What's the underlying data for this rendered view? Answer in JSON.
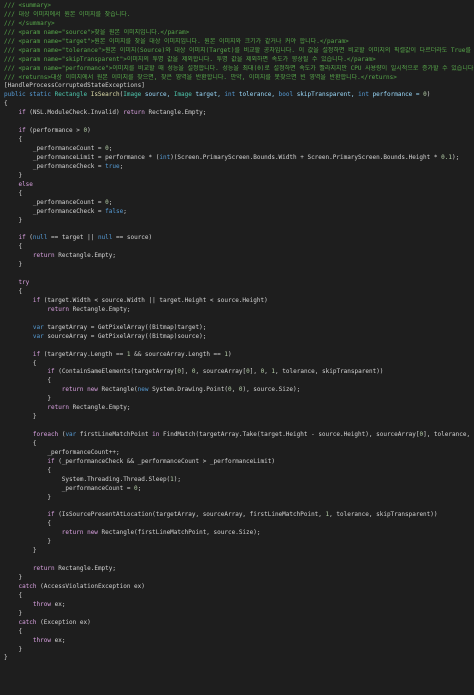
{
  "theme": {
    "background": "#1e1e1e",
    "colors": {
      "plain": "#d4d4d4",
      "comment": "#57a64a",
      "keyword": "#569cd6",
      "control": "#d8a0df",
      "type": "#4ec9b0",
      "number": "#b5cea8",
      "param": "#9cdcfe",
      "method": "#dcdcaa"
    }
  },
  "code": {
    "language": "csharp",
    "lines": [
      [
        {
          "t": "/// <summary>",
          "k": "comment"
        }
      ],
      [
        {
          "t": "/// 대상 이미지에서 원본 이미지를 찾습니다.",
          "k": "comment"
        }
      ],
      [
        {
          "t": "/// </summary>",
          "k": "comment"
        }
      ],
      [
        {
          "t": "/// <param name=\"source\">찾을 원본 이미지입니다.</param>",
          "k": "comment"
        }
      ],
      [
        {
          "t": "/// <param name=\"target\">원본 이미지를 찾을 대상 이미지입니다. 원본 이미지와 크기가 같거나 커야 합니다.</param>",
          "k": "comment"
        }
      ],
      [
        {
          "t": "/// <param name=\"tolerance\">원본 이미지(Source)와 대상 이미지(Target)를 비교할 공차입니다. 이 값을 설정하면 비교할 이미지의 픽셀값이 다르더라도 True를 반환합니다.</param>",
          "k": "comment"
        }
      ],
      [
        {
          "t": "/// <param name=\"skipTransparent\">이미지의 투명 값을 제외합니다. 투명 값을 제외하면 속도가 향상될 수 있습니다.</param>",
          "k": "comment"
        }
      ],
      [
        {
          "t": "/// <param name=\"performance\">이미지를 비교할 때 성능을 설정합니다. 성능을 최대(0)로 설정하면 속도가 빨라지지만 CPU 사용량이 일시적으로 증가할 수 있습니다.</param>",
          "k": "comment"
        }
      ],
      [
        {
          "t": "/// <returns>대상 이미지에서 원본 이미지를 찾으면, 찾은 영역을 반환합니다. 만약, 이미지를 못찾으면 빈 영역을 반환합니다.</returns>",
          "k": "comment"
        }
      ],
      [
        {
          "t": "[HandleProcessCorruptedStateExceptions]",
          "k": "plain"
        }
      ],
      [
        {
          "t": "public static ",
          "k": "keyword"
        },
        {
          "t": "Rectangle ",
          "k": "type"
        },
        {
          "t": "IsSearch",
          "k": "method"
        },
        {
          "t": "(",
          "k": "plain"
        },
        {
          "t": "Image ",
          "k": "type"
        },
        {
          "t": "source, ",
          "k": "param"
        },
        {
          "t": "Image ",
          "k": "type"
        },
        {
          "t": "target, ",
          "k": "param"
        },
        {
          "t": "int ",
          "k": "keyword"
        },
        {
          "t": "tolerance, ",
          "k": "param"
        },
        {
          "t": "bool ",
          "k": "keyword"
        },
        {
          "t": "skipTransparent, ",
          "k": "param"
        },
        {
          "t": "int ",
          "k": "keyword"
        },
        {
          "t": "performance = ",
          "k": "param"
        },
        {
          "t": "0",
          "k": "number"
        },
        {
          "t": ")",
          "k": "plain"
        }
      ],
      [
        {
          "t": "{",
          "k": "plain"
        }
      ],
      [
        {
          "t": "    ",
          "k": "plain"
        },
        {
          "t": "if ",
          "k": "control"
        },
        {
          "t": "(NSL.ModuleCheck.Invalid) ",
          "k": "plain"
        },
        {
          "t": "return ",
          "k": "control"
        },
        {
          "t": "Rectangle.Empty;",
          "k": "plain"
        }
      ],
      [
        {
          "t": "",
          "k": "plain"
        }
      ],
      [
        {
          "t": "    ",
          "k": "plain"
        },
        {
          "t": "if ",
          "k": "control"
        },
        {
          "t": "(performance > ",
          "k": "plain"
        },
        {
          "t": "0",
          "k": "number"
        },
        {
          "t": ")",
          "k": "plain"
        }
      ],
      [
        {
          "t": "    {",
          "k": "plain"
        }
      ],
      [
        {
          "t": "        _performanceCount = ",
          "k": "plain"
        },
        {
          "t": "0",
          "k": "number"
        },
        {
          "t": ";",
          "k": "plain"
        }
      ],
      [
        {
          "t": "        _performanceLimit = performance * (",
          "k": "plain"
        },
        {
          "t": "int",
          "k": "keyword"
        },
        {
          "t": ")(Screen.PrimaryScreen.Bounds.Width + Screen.PrimaryScreen.Bounds.Height * ",
          "k": "plain"
        },
        {
          "t": "0.1",
          "k": "number"
        },
        {
          "t": ");",
          "k": "plain"
        }
      ],
      [
        {
          "t": "        _performanceCheck = ",
          "k": "plain"
        },
        {
          "t": "true",
          "k": "keyword"
        },
        {
          "t": ";",
          "k": "plain"
        }
      ],
      [
        {
          "t": "    }",
          "k": "plain"
        }
      ],
      [
        {
          "t": "    ",
          "k": "plain"
        },
        {
          "t": "else",
          "k": "control"
        }
      ],
      [
        {
          "t": "    {",
          "k": "plain"
        }
      ],
      [
        {
          "t": "        _performanceCount = ",
          "k": "plain"
        },
        {
          "t": "0",
          "k": "number"
        },
        {
          "t": ";",
          "k": "plain"
        }
      ],
      [
        {
          "t": "        _performanceCheck = ",
          "k": "plain"
        },
        {
          "t": "false",
          "k": "keyword"
        },
        {
          "t": ";",
          "k": "plain"
        }
      ],
      [
        {
          "t": "    }",
          "k": "plain"
        }
      ],
      [
        {
          "t": "",
          "k": "plain"
        }
      ],
      [
        {
          "t": "    ",
          "k": "plain"
        },
        {
          "t": "if ",
          "k": "control"
        },
        {
          "t": "(",
          "k": "plain"
        },
        {
          "t": "null ",
          "k": "keyword"
        },
        {
          "t": "== target || ",
          "k": "plain"
        },
        {
          "t": "null ",
          "k": "keyword"
        },
        {
          "t": "== source)",
          "k": "plain"
        }
      ],
      [
        {
          "t": "    {",
          "k": "plain"
        }
      ],
      [
        {
          "t": "        ",
          "k": "plain"
        },
        {
          "t": "return ",
          "k": "control"
        },
        {
          "t": "Rectangle.Empty;",
          "k": "plain"
        }
      ],
      [
        {
          "t": "    }",
          "k": "plain"
        }
      ],
      [
        {
          "t": "",
          "k": "plain"
        }
      ],
      [
        {
          "t": "    ",
          "k": "plain"
        },
        {
          "t": "try",
          "k": "control"
        }
      ],
      [
        {
          "t": "    {",
          "k": "plain"
        }
      ],
      [
        {
          "t": "        ",
          "k": "plain"
        },
        {
          "t": "if ",
          "k": "control"
        },
        {
          "t": "(target.Width < source.Width || target.Height < source.Height)",
          "k": "plain"
        }
      ],
      [
        {
          "t": "            ",
          "k": "plain"
        },
        {
          "t": "return ",
          "k": "control"
        },
        {
          "t": "Rectangle.Empty;",
          "k": "plain"
        }
      ],
      [
        {
          "t": "",
          "k": "plain"
        }
      ],
      [
        {
          "t": "        ",
          "k": "plain"
        },
        {
          "t": "var ",
          "k": "keyword"
        },
        {
          "t": "targetArray = GetPixelArray((Bitmap)target);",
          "k": "plain"
        }
      ],
      [
        {
          "t": "        ",
          "k": "plain"
        },
        {
          "t": "var ",
          "k": "keyword"
        },
        {
          "t": "sourceArray = GetPixelArray((Bitmap)source);",
          "k": "plain"
        }
      ],
      [
        {
          "t": "",
          "k": "plain"
        }
      ],
      [
        {
          "t": "        ",
          "k": "plain"
        },
        {
          "t": "if ",
          "k": "control"
        },
        {
          "t": "(targetArray.Length == ",
          "k": "plain"
        },
        {
          "t": "1 ",
          "k": "number"
        },
        {
          "t": "&& sourceArray.Length == ",
          "k": "plain"
        },
        {
          "t": "1",
          "k": "number"
        },
        {
          "t": ")",
          "k": "plain"
        }
      ],
      [
        {
          "t": "        {",
          "k": "plain"
        }
      ],
      [
        {
          "t": "            ",
          "k": "plain"
        },
        {
          "t": "if ",
          "k": "control"
        },
        {
          "t": "(ContainSameElements(targetArray[",
          "k": "plain"
        },
        {
          "t": "0",
          "k": "number"
        },
        {
          "t": "], ",
          "k": "plain"
        },
        {
          "t": "0",
          "k": "number"
        },
        {
          "t": ", sourceArray[",
          "k": "plain"
        },
        {
          "t": "0",
          "k": "number"
        },
        {
          "t": "], ",
          "k": "plain"
        },
        {
          "t": "0",
          "k": "number"
        },
        {
          "t": ", ",
          "k": "plain"
        },
        {
          "t": "1",
          "k": "number"
        },
        {
          "t": ", tolerance, skipTransparent))",
          "k": "plain"
        }
      ],
      [
        {
          "t": "            {",
          "k": "plain"
        }
      ],
      [
        {
          "t": "                ",
          "k": "plain"
        },
        {
          "t": "return new ",
          "k": "control"
        },
        {
          "t": "Rectangle(",
          "k": "plain"
        },
        {
          "t": "new ",
          "k": "keyword"
        },
        {
          "t": "System.Drawing.Point(",
          "k": "plain"
        },
        {
          "t": "0",
          "k": "number"
        },
        {
          "t": ", ",
          "k": "plain"
        },
        {
          "t": "0",
          "k": "number"
        },
        {
          "t": "), source.Size);",
          "k": "plain"
        }
      ],
      [
        {
          "t": "            }",
          "k": "plain"
        }
      ],
      [
        {
          "t": "            ",
          "k": "plain"
        },
        {
          "t": "return ",
          "k": "control"
        },
        {
          "t": "Rectangle.Empty;",
          "k": "plain"
        }
      ],
      [
        {
          "t": "        }",
          "k": "plain"
        }
      ],
      [
        {
          "t": "",
          "k": "plain"
        }
      ],
      [
        {
          "t": "        ",
          "k": "plain"
        },
        {
          "t": "foreach ",
          "k": "control"
        },
        {
          "t": "(",
          "k": "plain"
        },
        {
          "t": "var ",
          "k": "keyword"
        },
        {
          "t": "firstLineMatchPoint ",
          "k": "plain"
        },
        {
          "t": "in ",
          "k": "control"
        },
        {
          "t": "FindMatch(targetArray.Take(target.Height - source.Height), sourceArray[",
          "k": "plain"
        },
        {
          "t": "0",
          "k": "number"
        },
        {
          "t": "], tolerance, skipTransparent))",
          "k": "plain"
        }
      ],
      [
        {
          "t": "        {",
          "k": "plain"
        }
      ],
      [
        {
          "t": "            _performanceCount++;",
          "k": "plain"
        }
      ],
      [
        {
          "t": "            ",
          "k": "plain"
        },
        {
          "t": "if ",
          "k": "control"
        },
        {
          "t": "(_performanceCheck && _performanceCount > _performanceLimit)",
          "k": "plain"
        }
      ],
      [
        {
          "t": "            {",
          "k": "plain"
        }
      ],
      [
        {
          "t": "                System.Threading.Thread.Sleep(",
          "k": "plain"
        },
        {
          "t": "1",
          "k": "number"
        },
        {
          "t": ");",
          "k": "plain"
        }
      ],
      [
        {
          "t": "                _performanceCount = ",
          "k": "plain"
        },
        {
          "t": "0",
          "k": "number"
        },
        {
          "t": ";",
          "k": "plain"
        }
      ],
      [
        {
          "t": "            }",
          "k": "plain"
        }
      ],
      [
        {
          "t": "",
          "k": "plain"
        }
      ],
      [
        {
          "t": "            ",
          "k": "plain"
        },
        {
          "t": "if ",
          "k": "control"
        },
        {
          "t": "(IsSourcePresentAtLocation(targetArray, sourceArray, firstLineMatchPoint, ",
          "k": "plain"
        },
        {
          "t": "1",
          "k": "number"
        },
        {
          "t": ", tolerance, skipTransparent))",
          "k": "plain"
        }
      ],
      [
        {
          "t": "            {",
          "k": "plain"
        }
      ],
      [
        {
          "t": "                ",
          "k": "plain"
        },
        {
          "t": "return new ",
          "k": "control"
        },
        {
          "t": "Rectangle(firstLineMatchPoint, source.Size);",
          "k": "plain"
        }
      ],
      [
        {
          "t": "            }",
          "k": "plain"
        }
      ],
      [
        {
          "t": "        }",
          "k": "plain"
        }
      ],
      [
        {
          "t": "",
          "k": "plain"
        }
      ],
      [
        {
          "t": "        ",
          "k": "plain"
        },
        {
          "t": "return ",
          "k": "control"
        },
        {
          "t": "Rectangle.Empty;",
          "k": "plain"
        }
      ],
      [
        {
          "t": "    }",
          "k": "plain"
        }
      ],
      [
        {
          "t": "    ",
          "k": "plain"
        },
        {
          "t": "catch ",
          "k": "control"
        },
        {
          "t": "(AccessViolationException ex)",
          "k": "plain"
        }
      ],
      [
        {
          "t": "    {",
          "k": "plain"
        }
      ],
      [
        {
          "t": "        ",
          "k": "plain"
        },
        {
          "t": "throw ",
          "k": "control"
        },
        {
          "t": "ex;",
          "k": "plain"
        }
      ],
      [
        {
          "t": "    }",
          "k": "plain"
        }
      ],
      [
        {
          "t": "    ",
          "k": "plain"
        },
        {
          "t": "catch ",
          "k": "control"
        },
        {
          "t": "(Exception ex)",
          "k": "plain"
        }
      ],
      [
        {
          "t": "    {",
          "k": "plain"
        }
      ],
      [
        {
          "t": "        ",
          "k": "plain"
        },
        {
          "t": "throw ",
          "k": "control"
        },
        {
          "t": "ex;",
          "k": "plain"
        }
      ],
      [
        {
          "t": "    }",
          "k": "plain"
        }
      ],
      [
        {
          "t": "}",
          "k": "plain"
        }
      ]
    ]
  }
}
